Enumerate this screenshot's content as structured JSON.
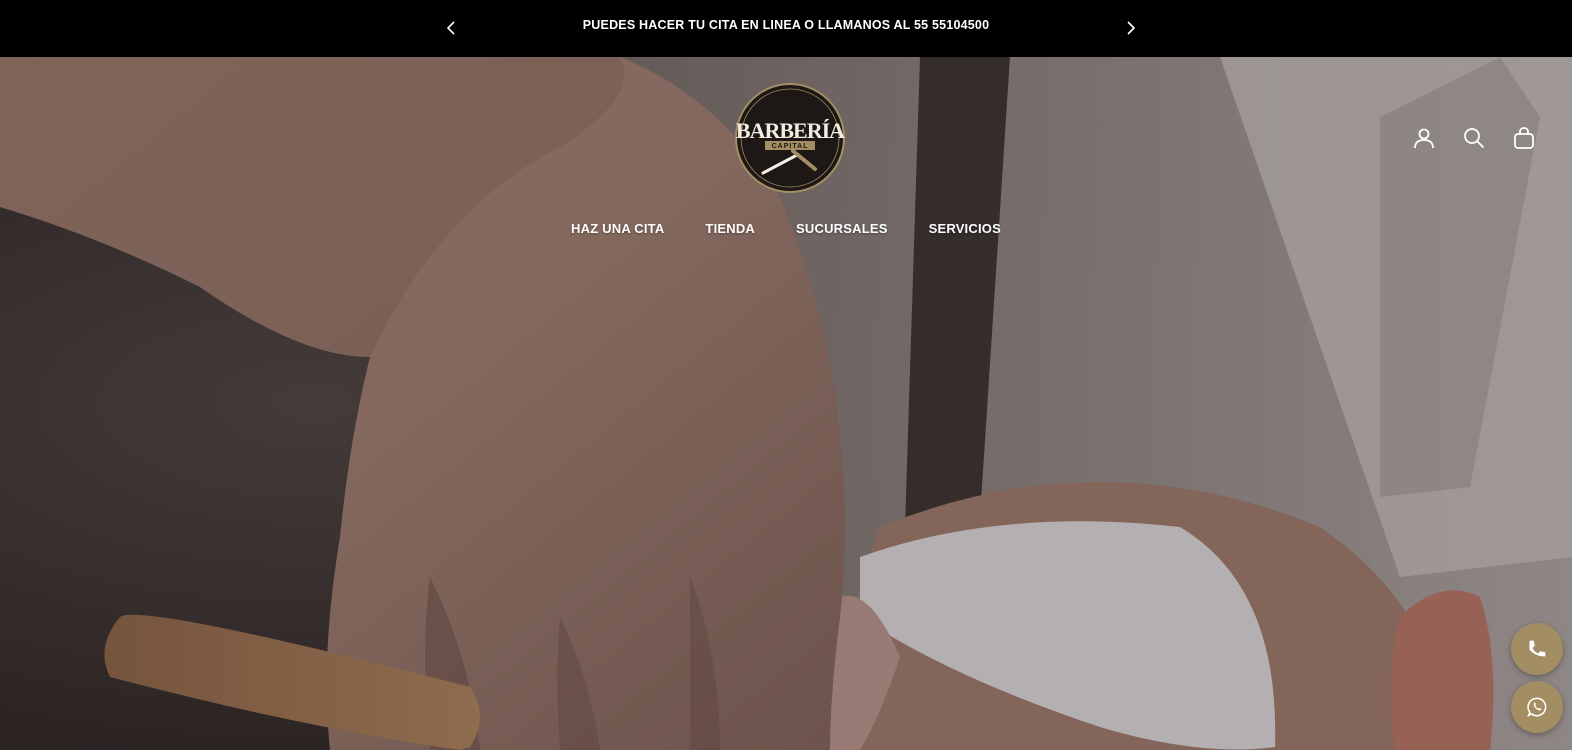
{
  "announcement": {
    "message": "PUEDES HACER TU CITA EN LINEA O LLAMANOS AL 55 55104500",
    "prev_icon": "chevron-left-icon",
    "next_icon": "chevron-right-icon"
  },
  "brand": {
    "name": "BARBERÍA",
    "sub": "CAPITAL",
    "accent_color": "#a38e64"
  },
  "nav": {
    "items": [
      {
        "label": "HAZ UNA CITA"
      },
      {
        "label": "TIENDA"
      },
      {
        "label": "SUCURSALES"
      },
      {
        "label": "SERVICIOS"
      }
    ]
  },
  "header_icons": [
    "account-icon",
    "search-icon",
    "cart-icon"
  ],
  "floating": {
    "phone_icon": "phone-icon",
    "whatsapp_icon": "whatsapp-icon"
  }
}
